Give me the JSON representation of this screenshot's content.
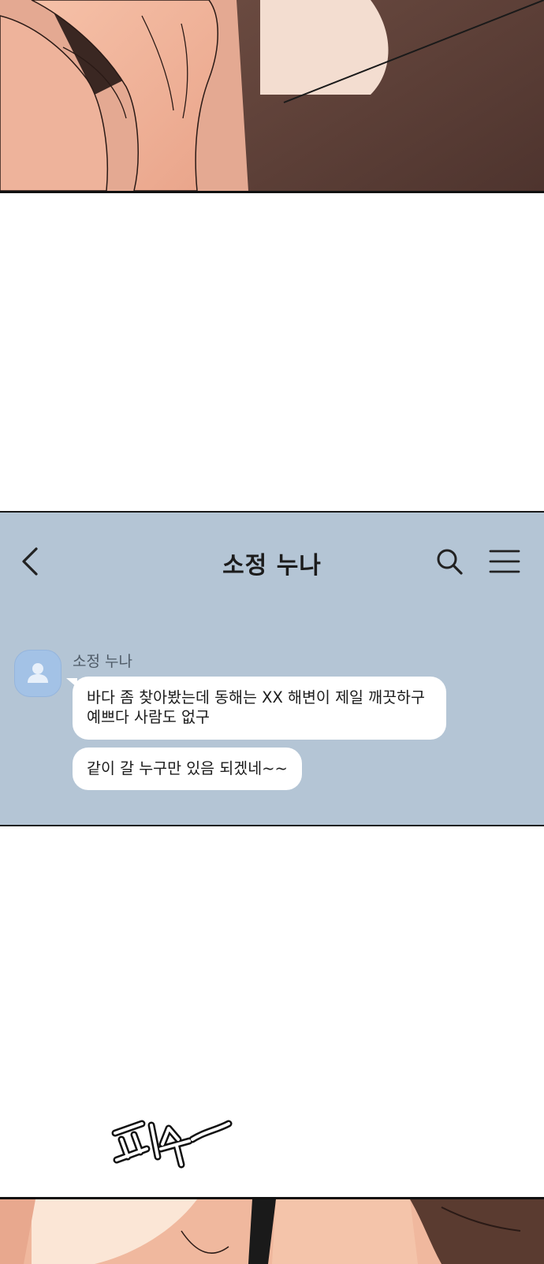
{
  "chat": {
    "title": "소정 누나",
    "sender": "소정 누나",
    "messages": [
      {
        "lines": [
          "바다 좀 찾아봤는데 동해는 XX 해변이 제일 깨끗하구",
          "예쁘다 사람도 없구"
        ]
      },
      {
        "lines": [
          "같이 갈 누구만 있음 되겠네~~"
        ]
      }
    ]
  },
  "icons": {
    "back": "chevron-left-icon",
    "search": "search-icon",
    "menu": "hamburger-menu-icon",
    "avatar": "person-icon"
  },
  "colors": {
    "chat_background": "#b4c5d5",
    "bubble": "#ffffff",
    "avatar": "#a3c2e6",
    "skin": "#f2b49a",
    "dark_clothing": "#5c4038"
  },
  "sfx_text": "피식"
}
